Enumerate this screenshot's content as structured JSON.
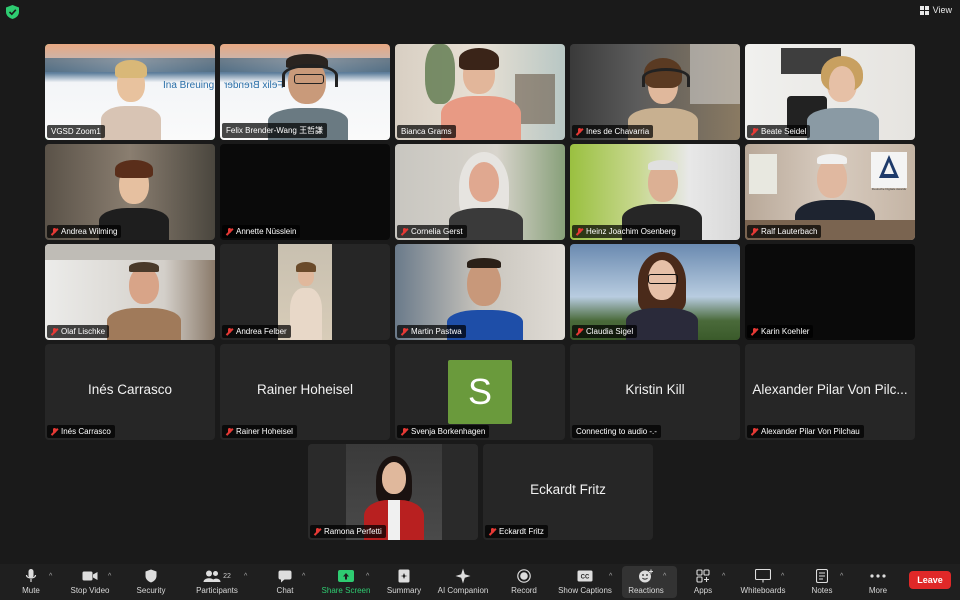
{
  "topbar": {
    "view_label": "View"
  },
  "participants": [
    {
      "display": "VGSD Zoom1",
      "video": true,
      "muted": false,
      "active_speaker": true,
      "background_text": "Ina Breuing"
    },
    {
      "display": "Felix Brender-Wang 王哲謙",
      "video": true,
      "muted": false,
      "background_text": "Felix Brender"
    },
    {
      "display": "Bianca Grams",
      "video": true,
      "muted": false
    },
    {
      "display": "Ines de Chavarria",
      "video": true,
      "muted": true
    },
    {
      "display": "Beate Seidel",
      "video": true,
      "muted": true
    },
    {
      "display": "Andrea Wilming",
      "video": true,
      "muted": true
    },
    {
      "display": "Annette Nüsslein",
      "video": false,
      "muted": true
    },
    {
      "display": "Cornelia Gerst",
      "video": true,
      "muted": true
    },
    {
      "display": "Heinz Joachim Osenberg",
      "video": true,
      "muted": true
    },
    {
      "display": "Ralf Lauterbach",
      "video": true,
      "muted": true
    },
    {
      "display": "Olaf Lischke",
      "video": true,
      "muted": true
    },
    {
      "display": "Andrea Felber",
      "video": true,
      "muted": true
    },
    {
      "display": "Martin Pastwa",
      "video": true,
      "muted": true
    },
    {
      "display": "Claudia Sigel",
      "video": true,
      "muted": true
    },
    {
      "display": "Karin Koehler",
      "video": false,
      "muted": true
    },
    {
      "display": "Inés Carrasco",
      "video": false,
      "muted": true,
      "big_name": "Inés Carrasco"
    },
    {
      "display": "Rainer Hoheisel",
      "video": false,
      "muted": true,
      "big_name": "Rainer Hoheisel"
    },
    {
      "display": "Svenja Borkenhagen",
      "video": false,
      "muted": true,
      "avatar_letter": "S"
    },
    {
      "display": "Connecting to audio  -.-",
      "video": false,
      "muted": false,
      "big_name": "Kristin Kill"
    },
    {
      "display": "Alexander Pilar Von Pilchau",
      "video": false,
      "muted": true,
      "big_name": "Alexander Pilar Von Pilc..."
    },
    {
      "display": "Ramona Perfetti",
      "video": true,
      "muted": true
    },
    {
      "display": "Eckardt Fritz",
      "video": false,
      "muted": true,
      "big_name": "Eckardt Fritz"
    }
  ],
  "ralf_logo_text": "Deutsche Digitale Awards",
  "toolbar": {
    "mute": "Mute",
    "stop_video": "Stop Video",
    "security": "Security",
    "participants": "Participants",
    "participants_count": "22",
    "chat": "Chat",
    "share_screen": "Share Screen",
    "summary": "Summary",
    "ai_companion": "AI Companion",
    "record": "Record",
    "show_captions": "Show Captions",
    "reactions": "Reactions",
    "apps": "Apps",
    "whiteboards": "Whiteboards",
    "notes": "Notes",
    "more": "More",
    "leave": "Leave"
  },
  "colors": {
    "accent_green": "#22c55e",
    "share_green": "#2ecc71",
    "leave_red": "#e02828",
    "svenja_avatar": "#6a9a3c"
  }
}
